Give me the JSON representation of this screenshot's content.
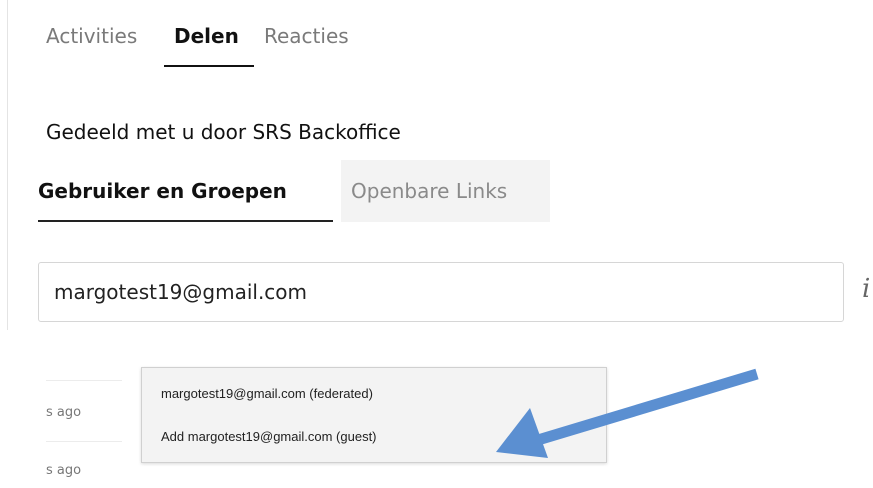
{
  "tabs": {
    "activities": "Activities",
    "delen": "Delen",
    "reacties": "Reacties"
  },
  "shared_info": "Gedeeld met u door SRS Backoffice",
  "subtabs": {
    "users_groups": "Gebruiker en Groepen",
    "public_links": "Openbare Links"
  },
  "search": {
    "value": "margotest19@gmail.com"
  },
  "info_icon_glyph": "i",
  "activity": {
    "items": [
      {
        "time": "s ago"
      },
      {
        "time": "s ago"
      }
    ]
  },
  "autocomplete": {
    "options": [
      {
        "label": "margotest19@gmail.com (federated)"
      },
      {
        "label": "Add margotest19@gmail.com (guest)"
      }
    ]
  },
  "colors": {
    "annotation_arrow": "#5b8fd1",
    "active_text": "#111111",
    "inactive_text": "#7a7a7a"
  }
}
